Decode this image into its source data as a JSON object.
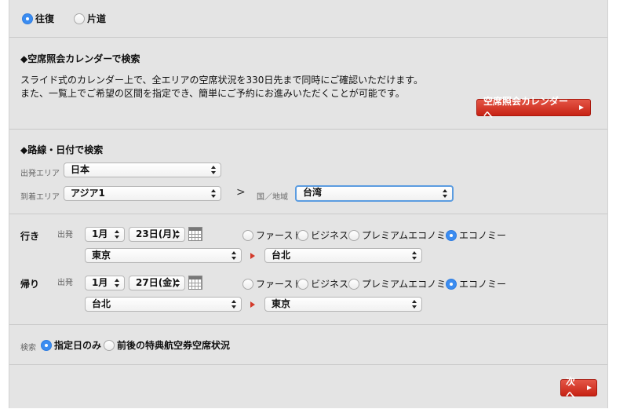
{
  "trip_type": {
    "round_trip": "往復",
    "one_way": "片道",
    "selected": "round_trip"
  },
  "calendar_section": {
    "title": "◆空席照会カレンダーで検索",
    "desc_line1": "スライド式のカレンダー上で、全エリアの空席状況を330日先まで同時にご確認いただけます。",
    "desc_line2": "また、一覧上でご希望の区間を指定でき、簡単にご予約にお進みいただくことが可能です。",
    "button_label": "空席照会カレンダーへ"
  },
  "route_section": {
    "title": "◆路線・日付で検索",
    "departure_area_label": "出発エリア",
    "departure_area_value": "日本",
    "arrival_area_label": "到着エリア",
    "arrival_area_value": "アジア1",
    "separator": ">",
    "country_label": "国／地域",
    "country_value": "台湾"
  },
  "outbound": {
    "label": "行き",
    "sub_label": "出発",
    "month": "1月",
    "day": "23日(月)",
    "classes": [
      "ファースト",
      "ビジネス",
      "プレミアムエコノミー",
      "エコノミー"
    ],
    "selected_class": "エコノミー",
    "from": "東京",
    "to": "台北"
  },
  "return": {
    "label": "帰り",
    "sub_label": "出発",
    "month": "1月",
    "day": "27日(金)",
    "classes": [
      "ファースト",
      "ビジネス",
      "プレミアムエコノミー",
      "エコノミー"
    ],
    "selected_class": "エコノミー",
    "from": "台北",
    "to": "東京"
  },
  "search": {
    "label": "検索",
    "specified_date_only": "指定日のみ",
    "around_dates": "前後の特典航空券空席状況",
    "selected": "specified_date_only"
  },
  "next_button": "次へ",
  "colors": {
    "panel_bg": "#e4e4e4",
    "accent_red": "#d33a2a",
    "radio_blue": "#3b8cf0"
  }
}
